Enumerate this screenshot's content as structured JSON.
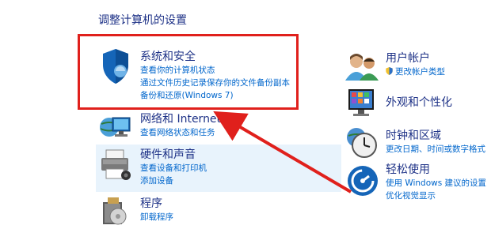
{
  "header": {
    "title": "调整计算机的设置"
  },
  "left": {
    "system": {
      "title": "系统和安全",
      "links": [
        "查看你的计算机状态",
        "通过文件历史记录保存你的文件备份副本",
        "备份和还原(Windows 7)"
      ]
    },
    "network": {
      "title": "网络和 Internet",
      "links": [
        "查看网络状态和任务"
      ]
    },
    "hardware": {
      "title": "硬件和声音",
      "links": [
        "查看设备和打印机",
        "添加设备"
      ]
    },
    "programs": {
      "title": "程序",
      "links": [
        "卸载程序"
      ]
    }
  },
  "right": {
    "accounts": {
      "title": "用户帐户",
      "links": [
        "更改帐户类型"
      ]
    },
    "appearance": {
      "title": "外观和个性化",
      "links": []
    },
    "clock": {
      "title": "时钟和区域",
      "links": [
        "更改日期、时间或数字格式"
      ]
    },
    "ease": {
      "title": "轻松使用",
      "links": [
        "使用 Windows 建议的设置",
        "优化视觉显示"
      ]
    }
  },
  "annotation": {
    "color": "#e0201c"
  }
}
